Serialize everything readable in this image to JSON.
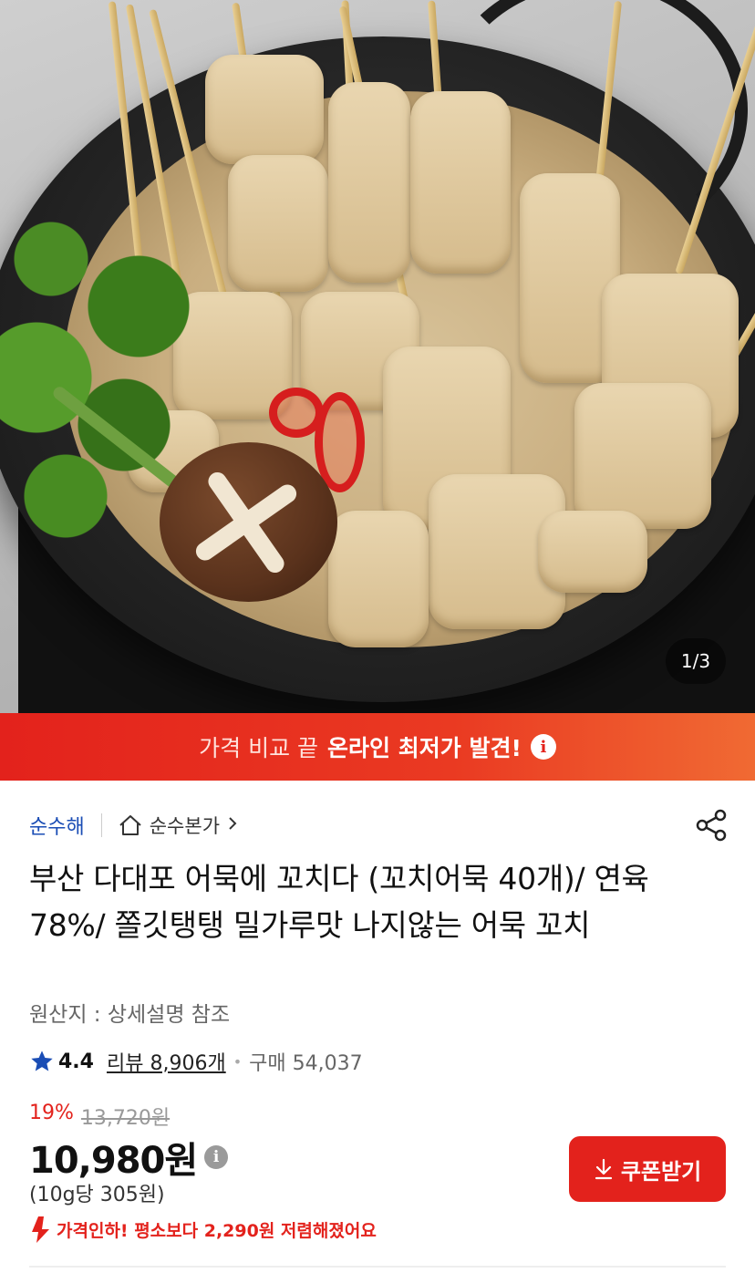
{
  "gallery": {
    "counter": "1/3"
  },
  "banner": {
    "prefix": "가격 비교 끝",
    "highlight": "온라인 최저가 발견!",
    "info_icon": "info-icon"
  },
  "seller": {
    "name": "순수해",
    "store_label": "순수본가",
    "store_icon": "home-icon",
    "share_icon": "share-icon"
  },
  "product": {
    "title": "부산 다대포 어묵에 꼬치다 (꼬치어묵 40개)/ 연육78%/ 쫄깃탱탱 밀가루맛 나지않는 어묵 꼬치",
    "origin": "원산지 : 상세설명 참조",
    "rating": "4.4",
    "reviews": "리뷰 8,906개",
    "purchases": "구매 54,037"
  },
  "pricing": {
    "discount_rate": "19%",
    "original_price": "13,720원",
    "sale_price": "10,980원",
    "unit_price": "(10g당 305원)",
    "price_drop": "가격인하! 평소보다 2,290원 저렴해졌어요"
  },
  "actions": {
    "coupon_label": "쿠폰받기",
    "coupon_icon": "download-icon"
  },
  "colors": {
    "accent": "#e3221c",
    "seller_link": "#1a4db5",
    "star": "#1a4db5"
  }
}
